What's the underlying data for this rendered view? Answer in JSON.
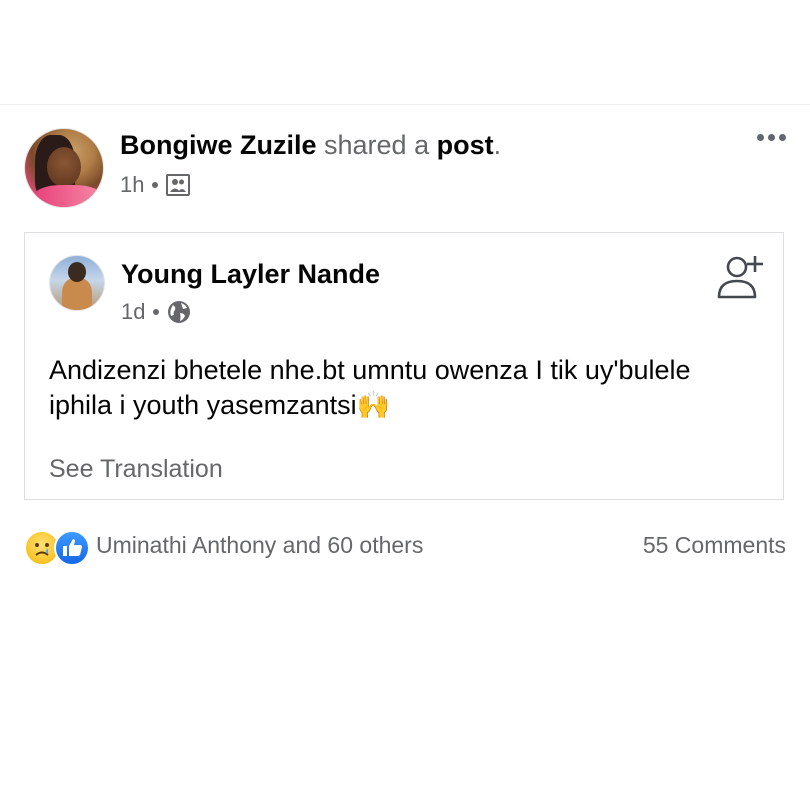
{
  "post": {
    "author": "Bongiwe Zuzile",
    "action_prefix": " shared a ",
    "action_object": "post",
    "action_suffix": ".",
    "time": "1h",
    "audience_icon": "group-icon"
  },
  "shared_post": {
    "author": "Young Layler Nande",
    "time": "1d",
    "audience_icon": "globe-icon",
    "text": "Andizenzi bhetele nhe.bt umntu owenza I tik uy'bulele iphila i youth yasemzantsi🙌",
    "see_translation": "See Translation"
  },
  "reactions": {
    "icons": [
      "sad-icon",
      "like-icon"
    ],
    "names": "Uminathi Anthony and 60 others",
    "comments": "55 Comments"
  },
  "colors": {
    "muted_text": "#65676b",
    "like_blue": "#1467e6",
    "card_border": "#dddfe2"
  }
}
